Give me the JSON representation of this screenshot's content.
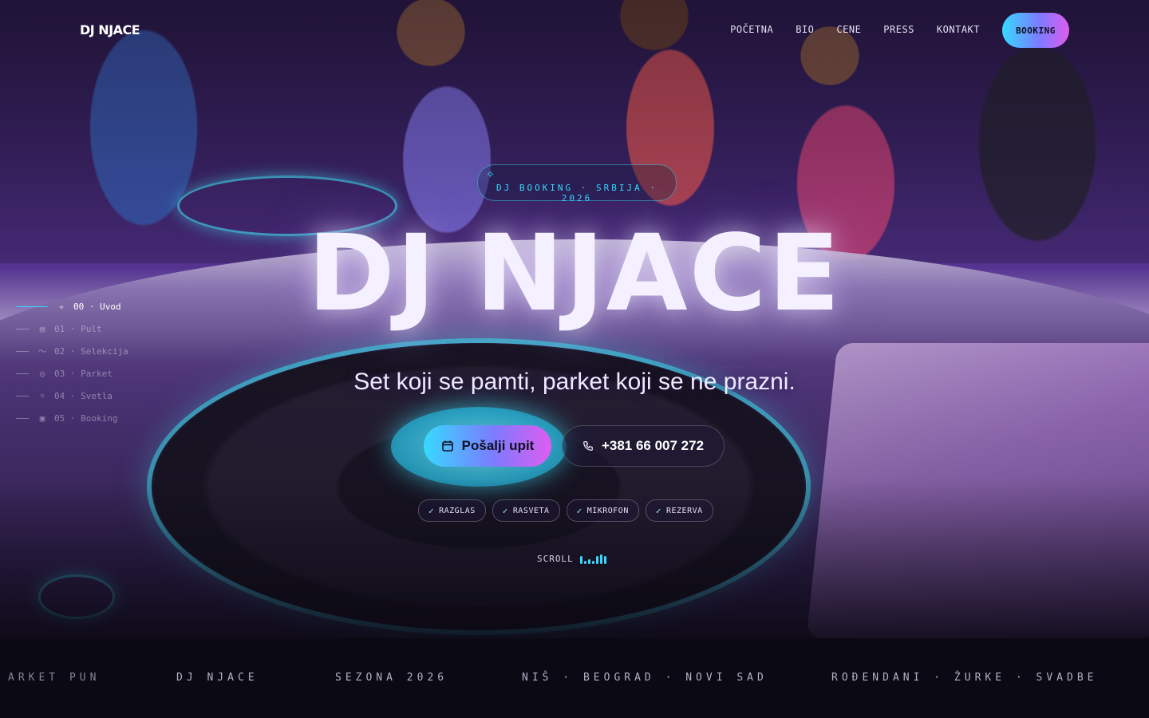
{
  "brand": {
    "logo": "DJ NJACE"
  },
  "nav": {
    "items": [
      "POČETNA",
      "BIO",
      "CENE",
      "PRESS",
      "KONTAKT"
    ],
    "booking_label": "BOOKING"
  },
  "side_nav": {
    "items": [
      {
        "label": "00 · Uvod",
        "icon": "sparkle-icon",
        "active": true
      },
      {
        "label": "01 · Pult",
        "icon": "mixer-icon",
        "active": false
      },
      {
        "label": "02 · Selekcija",
        "icon": "wave-icon",
        "active": false
      },
      {
        "label": "03 · Parket",
        "icon": "disc-icon",
        "active": false
      },
      {
        "label": "04 · Svetla",
        "icon": "bulb-icon",
        "active": false
      },
      {
        "label": "05 · Booking",
        "icon": "calendar-icon",
        "active": false
      }
    ]
  },
  "hero": {
    "badge": "DJ BOOKING · SRBIJA · 2026",
    "title": "DJ NJACE",
    "tagline": "Set koji se pamti, parket koji se ne prazni.",
    "cta_primary": "Pošalji upit",
    "cta_secondary": "+381 66 007 272",
    "features": [
      "RAZGLAS",
      "RASVETA",
      "MIKROFON",
      "REZERVA"
    ],
    "scroll_label": "SCROLL"
  },
  "ticker": {
    "items": [
      "ARKET PUN",
      "DJ NJACE",
      "SEZONA 2026",
      "NIŠ · BEOGRAD · NOVI SAD",
      "ROĐENDANI · ŽURKE · SVADBE"
    ]
  },
  "colors": {
    "accent_cyan": "#37d9ff",
    "accent_magenta": "#e05cf0",
    "background": "#0a0812"
  }
}
